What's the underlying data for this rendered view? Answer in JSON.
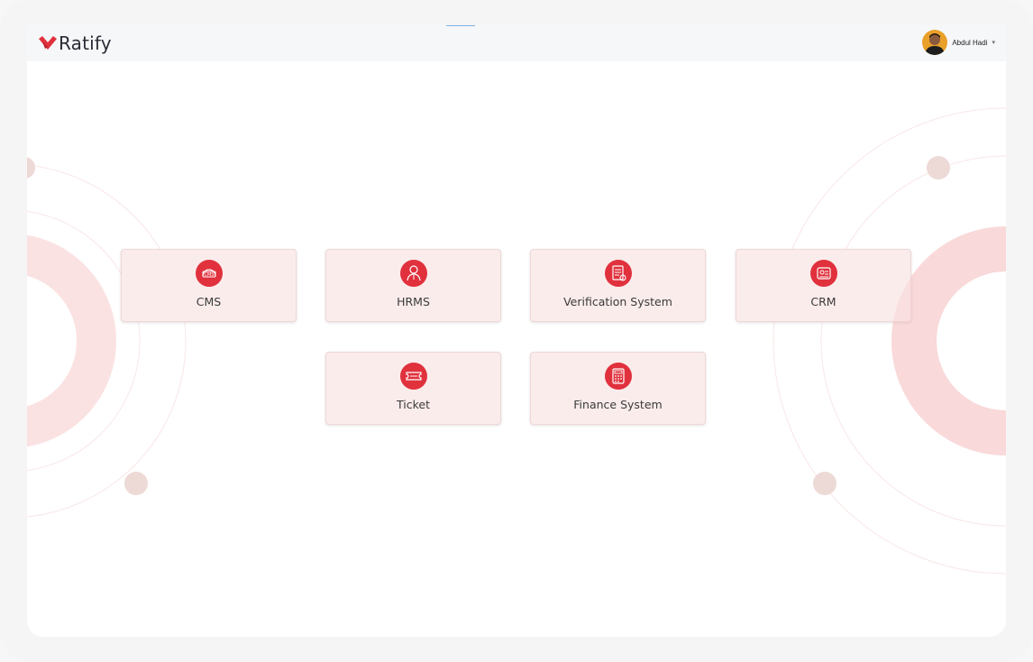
{
  "app": {
    "logo_text": "Ratify"
  },
  "user": {
    "name": "Abdul Hadi",
    "caret": "▾"
  },
  "modules": [
    {
      "label": "CMS",
      "icon": "cms-icon"
    },
    {
      "label": "HRMS",
      "icon": "hrms-person-icon"
    },
    {
      "label": "Verification System",
      "icon": "verification-document-icon"
    },
    {
      "label": "CRM",
      "icon": "crm-icon"
    },
    {
      "label": "Ticket",
      "icon": "ticket-icon"
    },
    {
      "label": "Finance System",
      "icon": "finance-calculator-icon"
    }
  ],
  "colors": {
    "brand_red": "#e0313d",
    "card_bg": "#fbecec",
    "decor_ring": "#fbe3e3",
    "decor_dot": "#edd9d6"
  }
}
